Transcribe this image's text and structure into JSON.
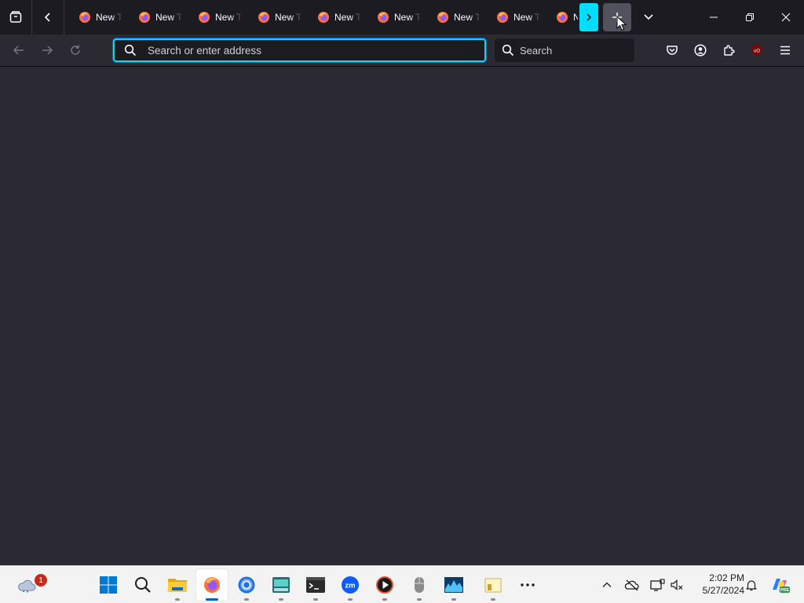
{
  "browser": {
    "tabs": [
      {
        "title": "New Tab"
      },
      {
        "title": "New Tab"
      },
      {
        "title": "New Tab"
      },
      {
        "title": "New Tab"
      },
      {
        "title": "New Tab"
      },
      {
        "title": "New Tab"
      },
      {
        "title": "New Tab"
      },
      {
        "title": "New Tab"
      },
      {
        "title": "New Tab"
      }
    ],
    "urlbar": {
      "placeholder": "Search or enter address",
      "value": ""
    },
    "searchbar": {
      "placeholder": "Search"
    },
    "accent": "#00ddff",
    "theme_bg": "#2b2a33"
  },
  "taskbar": {
    "widget_badge": "1",
    "apps": [
      {
        "name": "start"
      },
      {
        "name": "search"
      },
      {
        "name": "file-explorer"
      },
      {
        "name": "firefox",
        "active": true
      },
      {
        "name": "chrome"
      },
      {
        "name": "keyboard-app"
      },
      {
        "name": "terminal"
      },
      {
        "name": "zoom"
      },
      {
        "name": "media-player"
      },
      {
        "name": "mouse-app"
      },
      {
        "name": "monitor-app"
      },
      {
        "name": "more-apps"
      },
      {
        "name": "notes-app"
      }
    ],
    "clock": {
      "time": "2:02 PM",
      "date": "5/27/2024"
    },
    "copilot_badge": "PRE"
  }
}
